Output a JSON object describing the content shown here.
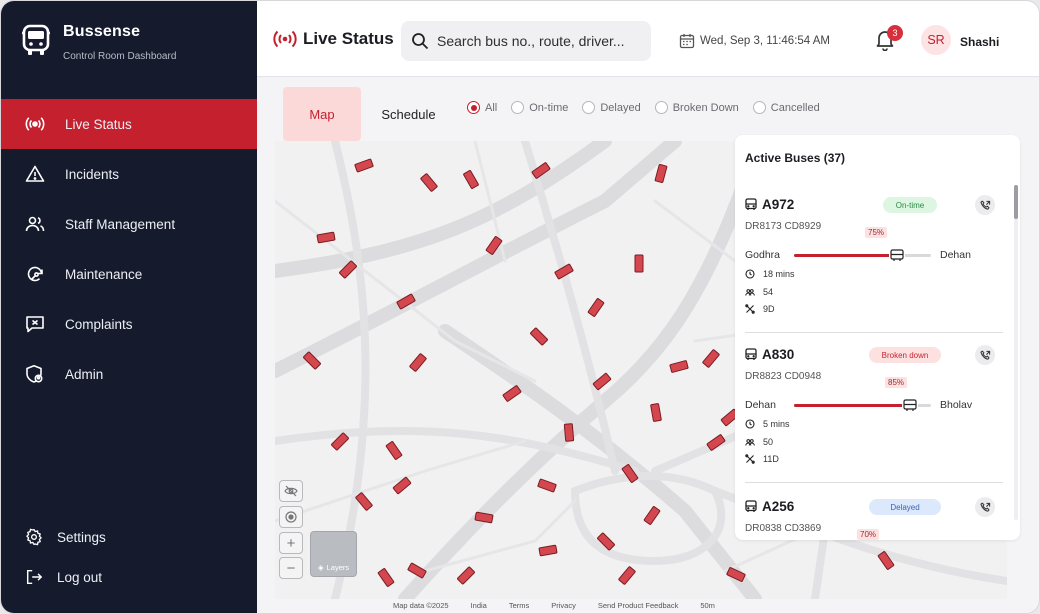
{
  "app": {
    "name": "Bussense",
    "subtitle": "Control Room Dashboard"
  },
  "sidebar": {
    "items": [
      {
        "label": "Live Status",
        "icon": "broadcast-icon",
        "active": true
      },
      {
        "label": "Incidents",
        "icon": "warning-icon",
        "active": false
      },
      {
        "label": "Staff Management",
        "icon": "users-icon",
        "active": false
      },
      {
        "label": "Maintenance",
        "icon": "wrench-refresh-icon",
        "active": false
      },
      {
        "label": "Complaints",
        "icon": "complaint-icon",
        "active": false
      },
      {
        "label": "Admin",
        "icon": "shield-user-icon",
        "active": false
      }
    ],
    "bottom": [
      {
        "label": "Settings",
        "icon": "gear-icon"
      },
      {
        "label": "Log out",
        "icon": "logout-icon"
      }
    ]
  },
  "header": {
    "title": "Live Status",
    "search_placeholder": "Search bus no., route, driver...",
    "datetime": "Wed, Sep 3, 11:46:54 AM",
    "notification_count": "3",
    "user_initials": "SR",
    "user_name": "Shashi"
  },
  "toolbar": {
    "tabs": [
      {
        "label": "Map",
        "active": true
      },
      {
        "label": "Schedule",
        "active": false
      }
    ],
    "filters": [
      {
        "label": "All",
        "checked": true
      },
      {
        "label": "On-time",
        "checked": false
      },
      {
        "label": "Delayed",
        "checked": false
      },
      {
        "label": "Broken Down",
        "checked": false
      },
      {
        "label": "Cancelled",
        "checked": false
      }
    ]
  },
  "map": {
    "layers_label": "Layers",
    "footer": [
      "Map data ©2025",
      "India",
      "Terms",
      "Privacy",
      "Send Product Feedback",
      "50m"
    ]
  },
  "panel": {
    "title": "Active Buses (37)",
    "buses": [
      {
        "bus_no": "A972",
        "codes": "DR8173   CD8929",
        "status": "On-time",
        "from": "Godhra",
        "to": "Dehan",
        "progress_pct": "75%",
        "progress": 0.75,
        "eta": "18 mins",
        "passengers": "54",
        "route": "9D"
      },
      {
        "bus_no": "A830",
        "codes": "DR8823  CD0948",
        "status": "Broken down",
        "from": "Dehan",
        "to": "Bholav",
        "progress_pct": "85%",
        "progress": 0.85,
        "eta": "5 mins",
        "passengers": "50",
        "route": "11D"
      },
      {
        "bus_no": "A256",
        "codes": "DR0838  CD3869",
        "status": "Delayed",
        "progress_pct": "70%",
        "progress": 0.7
      }
    ]
  },
  "colors": {
    "accent": "#c4202e",
    "sidebar_bg": "#151a2d",
    "on_time": "#2c8a45",
    "broken": "#c42632",
    "delayed": "#3d62b5"
  }
}
